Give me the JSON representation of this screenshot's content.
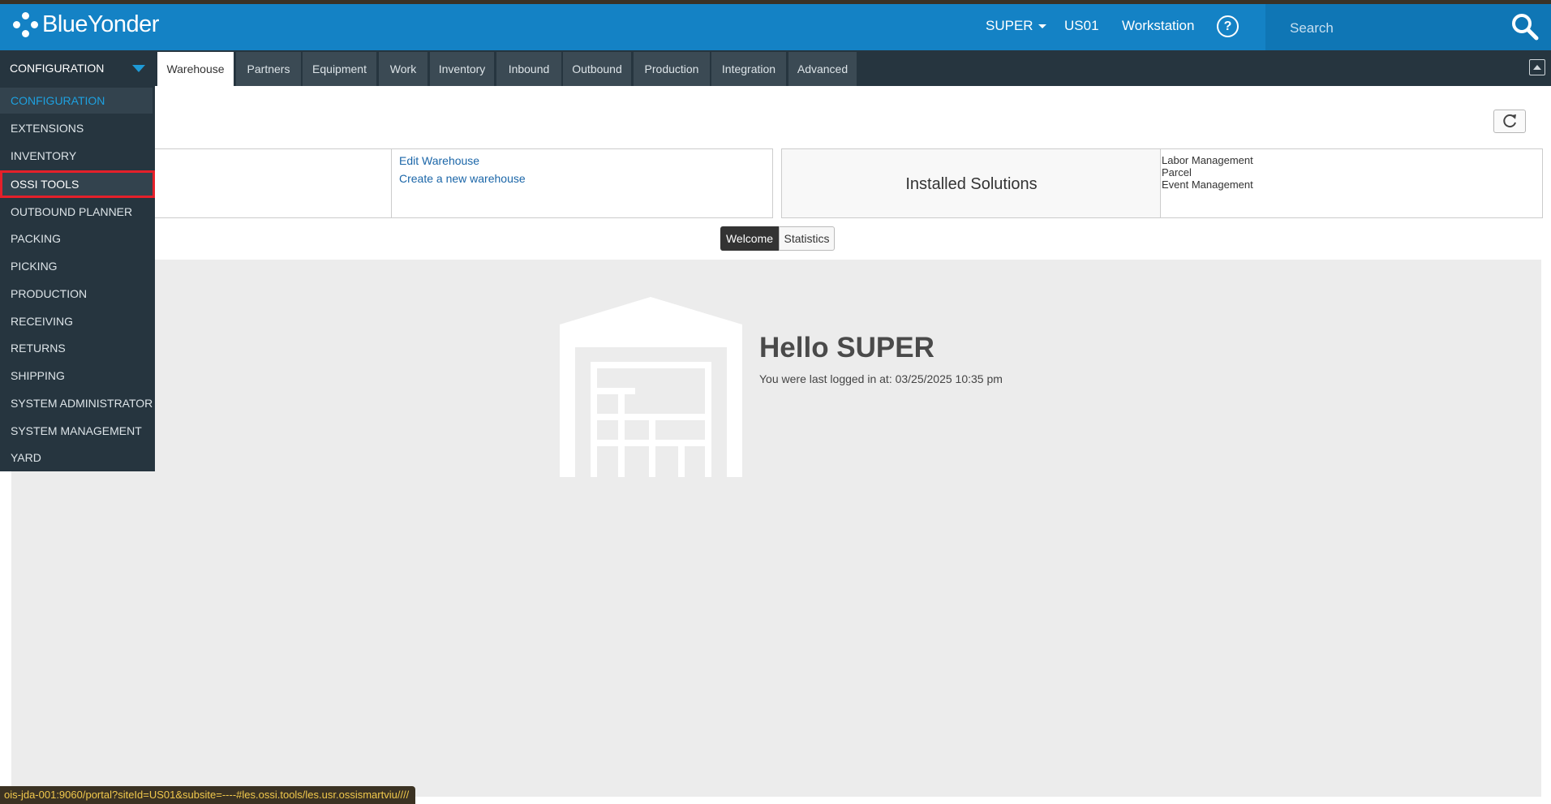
{
  "app": {
    "brand": "BlueYonder",
    "user_menu": "SUPER",
    "site": "US01",
    "workstation": "Workstation",
    "help_symbol": "?",
    "search_placeholder": "Search"
  },
  "config_dropdown": {
    "label": "CONFIGURATION"
  },
  "tabs": [
    {
      "label": "Warehouse",
      "active": true
    },
    {
      "label": "Partners"
    },
    {
      "label": "Equipment"
    },
    {
      "label": "Work"
    },
    {
      "label": "Inventory"
    },
    {
      "label": "Inbound"
    },
    {
      "label": "Outbound"
    },
    {
      "label": "Production"
    },
    {
      "label": "Integration"
    },
    {
      "label": "Advanced"
    }
  ],
  "menu": [
    {
      "label": "CONFIGURATION",
      "state": "selected"
    },
    {
      "label": "EXTENSIONS"
    },
    {
      "label": "INVENTORY"
    },
    {
      "label": "OSSI TOOLS",
      "state": "highlighted"
    },
    {
      "label": "OUTBOUND PLANNER"
    },
    {
      "label": "PACKING"
    },
    {
      "label": "PICKING"
    },
    {
      "label": "PRODUCTION"
    },
    {
      "label": "RECEIVING"
    },
    {
      "label": "RETURNS"
    },
    {
      "label": "SHIPPING"
    },
    {
      "label": "SYSTEM ADMINISTRATOR"
    },
    {
      "label": "SYSTEM MANAGEMENT"
    },
    {
      "label": "YARD"
    }
  ],
  "warehouse_links": {
    "edit": "Edit Warehouse",
    "create": "Create a new warehouse"
  },
  "installed": {
    "title": "Installed Solutions",
    "items": [
      "Labor Management",
      "Parcel",
      "Event Management"
    ]
  },
  "toggle": {
    "welcome": "Welcome",
    "statistics": "Statistics"
  },
  "welcome": {
    "greeting": "Hello SUPER",
    "last_login": "You were last logged in at: 03/25/2025 10:35 pm"
  },
  "status_url": "ois-jda-001:9060/portal?siteId=US01&subsite=----#les.ossi.tools/les.usr.ossismartviu////",
  "icons": {
    "search": "search-icon",
    "refresh": "refresh-icon",
    "collapse": "collapse-up-icon",
    "help": "help-icon",
    "warehouse": "warehouse-icon"
  },
  "colors": {
    "brand_blue": "#1482c5",
    "nav_dark": "#26353f",
    "tab_bg": "#3b4a54",
    "menu_selected_text": "#1ea1e0",
    "highlight_box": "#e5202a",
    "dashboard_bg": "#ececec",
    "link": "#1b66a8"
  }
}
